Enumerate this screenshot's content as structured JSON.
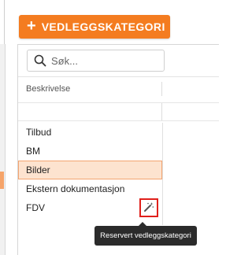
{
  "toolbar": {
    "add_button_icon": "plus-icon",
    "add_button_label": "VEDLEGGSKATEGORI",
    "accent_color": "#f47c20"
  },
  "search": {
    "placeholder": "Søk...",
    "value": "",
    "icon": "search-icon"
  },
  "table": {
    "columns": [
      "Beskrivelse"
    ],
    "rows": [
      {
        "label": "Tilbud",
        "selected": false
      },
      {
        "label": "BM",
        "selected": false
      },
      {
        "label": "Bilder",
        "selected": true
      },
      {
        "label": "Ekstern dokumentasjon",
        "selected": false
      },
      {
        "label": "FDV",
        "selected": false,
        "has_edit_button": true
      }
    ],
    "edit_icon": "magic-wand-icon",
    "selected_color": "#fde3cf"
  },
  "tooltip": {
    "text": "Reservert vedleggskategori"
  }
}
